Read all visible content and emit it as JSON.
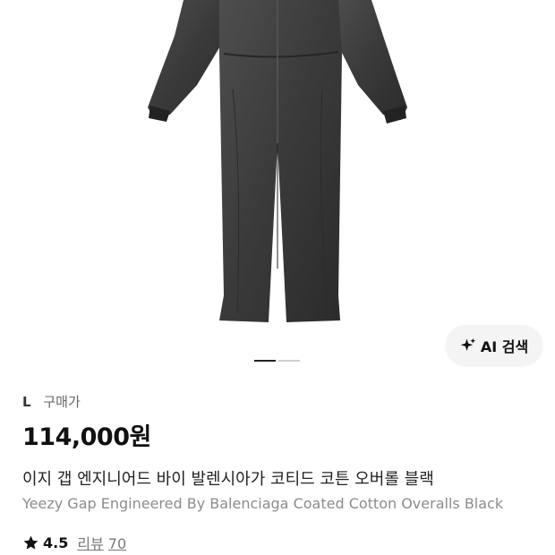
{
  "product": {
    "image_alt": "black coated cotton overalls",
    "carousel": {
      "current": 1,
      "total": 2
    },
    "ai_search_label": "AI 검색",
    "size": "L",
    "purchase_type": "구매가",
    "price": "114,000원",
    "title_ko": "이지 갭 엔지니어드 바이 발렌시아가 코티드 코튼 오버롤 블랙",
    "title_en": "Yeezy Gap Engineered By Balenciaga Coated Cotton Overalls Black",
    "rating": "4.5",
    "review_label": "리뷰",
    "review_count": "70"
  },
  "icons": {
    "ai": "sparkle-icon",
    "rating": "star-icon"
  },
  "colors": {
    "accent": "#111111",
    "muted": "#8c8c8c"
  }
}
